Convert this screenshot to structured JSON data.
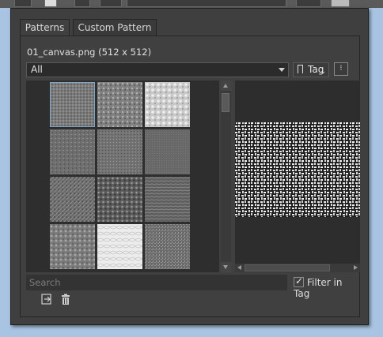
{
  "tabs": [
    {
      "label": "Patterns",
      "active": true
    },
    {
      "label": "Custom Pattern",
      "active": false
    }
  ],
  "resource": {
    "filename": "01_canvas.png (512 x 512)"
  },
  "tag_filter": {
    "selected": "All",
    "tag_button": "Tag",
    "info_icon": "info-icon"
  },
  "search": {
    "placeholder": "Search",
    "value": ""
  },
  "filter_in_tag": {
    "label": "Filter in Tag",
    "checked": true
  },
  "actions": {
    "import_icon": "import-icon",
    "delete_icon": "trash-icon"
  },
  "colors": {
    "background": "#a9c4e2",
    "panel": "#404040",
    "selection": "#7fa6c9"
  }
}
